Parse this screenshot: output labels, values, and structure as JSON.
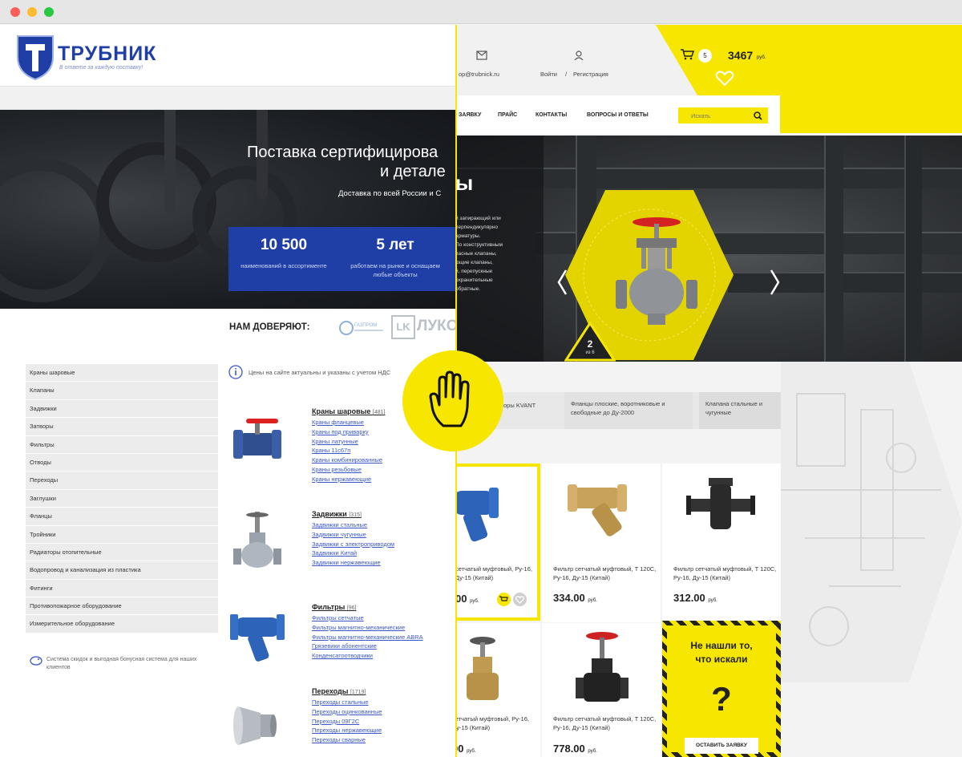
{
  "left_site": {
    "logo": {
      "name": "ТРУБНИК",
      "slogan": "В ответе за каждую поставку!"
    },
    "hero": {
      "title_line1": "Поставка сертифицирова",
      "title_line2": "и детале",
      "subtitle": "Доставка по всей России и С",
      "stats": [
        {
          "number": "10 500",
          "text": "наименований в ассортименте"
        },
        {
          "number": "5 лет",
          "text": "работаем на рынке и оснащаем любые объекты"
        }
      ]
    },
    "trust": {
      "label": "НАМ ДОВЕРЯЮТ:",
      "logo1": "ГАЗПРОМ",
      "logo2": "ЛУКО"
    },
    "categories": [
      "Краны шаровые",
      "Клапаны",
      "Задвижки",
      "Затворы",
      "Фильтры",
      "Отводы",
      "Переходы",
      "Заглушки",
      "Фланцы",
      "Тройники",
      "Радиаторы отопительные",
      "Водопровод и канализация из пластика",
      "Фитинги",
      "Противопожарное оборудование",
      "Измерительное оборудование"
    ],
    "bonus_text": "Система скидок и выгодная бонусная система для наших клиентов",
    "price_note": "Цены на сайте актуальны и указаны с учетом НДС",
    "products": [
      {
        "title": "Краны шаровые",
        "count": "[481]",
        "links": [
          "Краны фланцевые",
          "Краны под приварку",
          "Краны латунные",
          "Краны 11с67п",
          "Краны комбинированные",
          "Краны резьбовые",
          "Краны нержавеющие"
        ]
      },
      {
        "title": "Задвижки",
        "count": "[315]",
        "links": [
          "Задвижки стальные",
          "Задвижки чугунные",
          "Задвижки с электроприводом",
          "Задвижки Китай",
          "Задвижки нержавеющие"
        ]
      },
      {
        "title": "Фильтры",
        "count": "[96]",
        "links": [
          "Фильтры сетчатые",
          "Фильтры магнитно-механические",
          "Фильтры магнитно-механические ABRA",
          "Грязевики абонентские",
          "Конденсатоотводчики"
        ]
      },
      {
        "title": "Переходы",
        "count": "[1719]",
        "links": [
          "Переходы стальные",
          "Переходы оцинкованные",
          "Переходы 09Г2С",
          "Переходы нержавеющие",
          "Переходы сварные"
        ]
      }
    ]
  },
  "right_site": {
    "email": "op@trubnick.ru",
    "login": "Войти",
    "separator": "/",
    "register": "Регистрация",
    "cart_count": "5",
    "cart_total": "3467",
    "currency": "руб.",
    "nav": [
      "ЗАЯВКУ",
      "ПРАЙС",
      "КОНТАКТЫ",
      "ВОПРОСЫ И ОТВЕТЫ"
    ],
    "search_placeholder": "Искать",
    "hero": {
      "title_frag": "ы",
      "desc": [
        "й запирающий или",
        "перпендикулярно",
        "арматуры.",
        "По конструктивным",
        "пасные клапаны,",
        "ющие клапаны,",
        "й, перепускные",
        "охранительные",
        "обратные."
      ],
      "slide": "2",
      "slide_of": "из 6"
    },
    "tabs": [
      "оры KVANT",
      "Фланцы плоские, воротниковые и свободные до Ду-2000",
      "Клапана стальные и чугунные"
    ],
    "products": [
      {
        "name": "сетчатый муфтовый, Ру-16, Ду-15 (Китай)",
        "price": "00"
      },
      {
        "name": "Фильтр сетчатый муфтовый, Т 120С, Ру-16, Ду-15 (Китай)",
        "price": "334.00"
      },
      {
        "name": "Фильтр сетчатый муфтовый, Т 120С, Ру-16, Ду-15 (Китай)",
        "price": "312.00"
      },
      {
        "name": "сетчатый муфтовый, Ру-16, Ду-15 (Китай)",
        "price": "00"
      },
      {
        "name": "Фильтр сетчатый муфтовый, Т 120С, Ру-16, Ду-15 (Китай)",
        "price": "778.00"
      }
    ],
    "price_currency": "руб.",
    "notfound": {
      "line1": "Не нашли то,",
      "line2": "что искали",
      "mark": "?",
      "button": "ОСТАВИТЬ ЗАЯВКУ"
    }
  },
  "colors": {
    "brand_blue": "#1f3fa6",
    "accent_yellow": "#f6e600"
  }
}
